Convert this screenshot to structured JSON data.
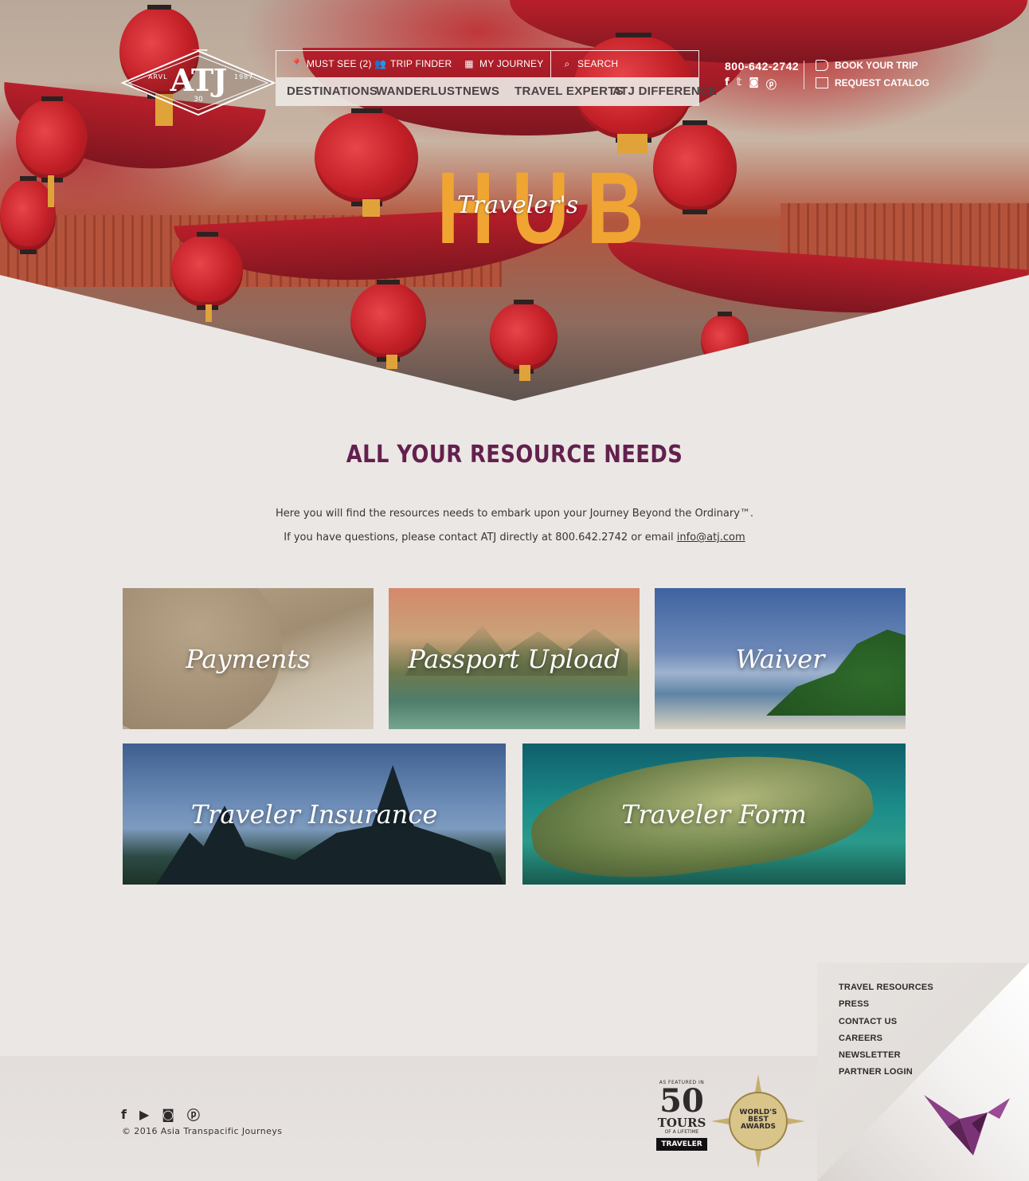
{
  "logo": {
    "title": "ATJ",
    "left_text": "ARVL",
    "right_text": "1987",
    "badge": "30"
  },
  "util_nav": [
    {
      "label": "MUST SEE (2)",
      "icon": "pin-icon"
    },
    {
      "label": "TRIP FINDER",
      "icon": "people-icon"
    },
    {
      "label": "MY JOURNEY",
      "icon": "map-icon"
    },
    {
      "label": "SEARCH",
      "icon": "search-icon"
    }
  ],
  "main_nav": [
    "DESTINATIONS",
    "WANDERLUST",
    "NEWS",
    "TRAVEL EXPERTS",
    "ATJ DIFFERENCE"
  ],
  "contact": {
    "phone": "800-642-2742"
  },
  "header_ctas": [
    {
      "label": "BOOK YOUR TRIP",
      "icon": "tag-icon"
    },
    {
      "label": "REQUEST CATALOG",
      "icon": "book-icon"
    }
  ],
  "hero": {
    "big_title": "HUB",
    "script_title": "Traveler's"
  },
  "intro": {
    "heading": "ALL YOUR RESOURCE NEEDS",
    "line1": "Here you will find the resources needs to embark upon your Journey Beyond the Ordinary™.",
    "line2_prefix": "If you have questions, please contact ATJ directly at 800.642.2742 or email ",
    "email": "info@atj.com"
  },
  "tiles": [
    "Payments",
    "Passport Upload",
    "Waiver",
    "Traveler Insurance",
    "Traveler Form"
  ],
  "footer": {
    "copyright": "© 2016 Asia Transpacific Journeys",
    "links": [
      "TRAVEL RESOURCES",
      "PRESS",
      "CONTACT US",
      "CAREERS",
      "NEWSLETTER",
      "PARTNER LOGIN"
    ],
    "award_50": {
      "featured": "AS FEATURED IN",
      "number": "50",
      "tours": "TOURS",
      "lifetime": "OF A LIFETIME",
      "badge": "TRAVELER"
    },
    "award_compass": {
      "line1": "WORLD'S",
      "line2": "BEST",
      "line3": "AWARDS"
    }
  },
  "colors": {
    "accent_purple": "#63204f",
    "hub_orange": "#f0a532",
    "page_bg": "#ebe7e4"
  }
}
